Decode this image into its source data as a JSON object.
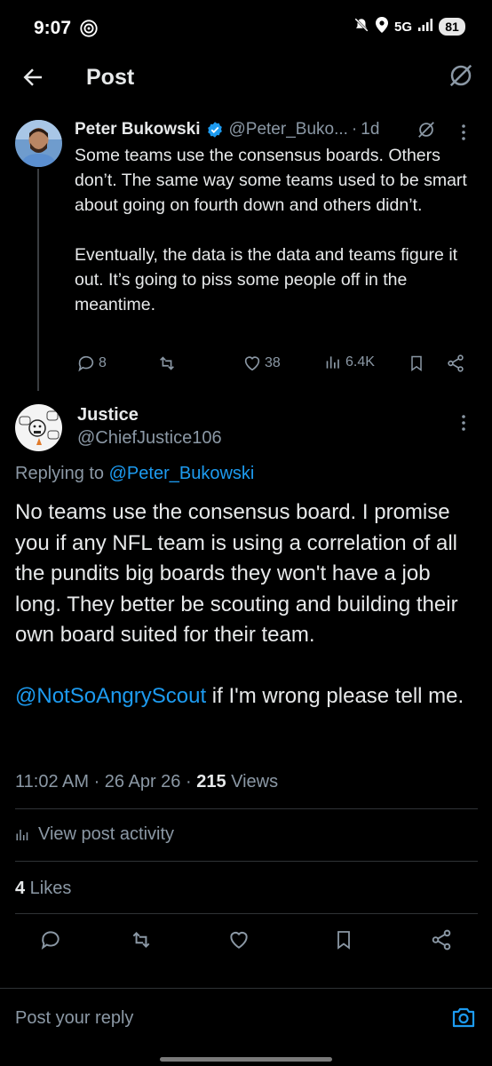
{
  "status_bar": {
    "time": "9:07",
    "network": "5G",
    "battery": "81"
  },
  "header": {
    "title": "Post"
  },
  "parent_post": {
    "author_name": "Peter Bukowski",
    "handle": "@Peter_Buko...",
    "dot": "·",
    "time": "1d",
    "paragraphs": [
      "Some teams use the consensus boards. Others don’t. The same way some teams used to be smart about going on fourth down and others didn’t.",
      "Eventually, the data is the data and teams figure it out. It’s going to piss some people off in the meantime."
    ],
    "replies": "8",
    "reposts": "",
    "likes": "38",
    "views": "6.4K"
  },
  "reply_post": {
    "author_name": "Justice",
    "handle": "@ChiefJustice106",
    "replying_prefix": "Replying to ",
    "replying_to": "@Peter_Bukowski",
    "paragraph1": "No teams use the consensus board.  I promise you if any NFL team is using a correlation of all the pundits big boards they won't have a job long.  They better be scouting and building their own board suited for their team.",
    "mention": "@NotSoAngryScout",
    "paragraph2_rest": " if I'm wrong please tell me.",
    "timestamp": "11:02 AM · 26 Apr 26 · ",
    "view_count": "215",
    "views_label": " Views",
    "activity_label": "View post activity",
    "likes_count": "4",
    "likes_label": " Likes"
  },
  "composer": {
    "placeholder": "Post your reply"
  },
  "colors": {
    "accent": "#1d9bf0",
    "background": "#000000",
    "muted": "#8b98a5",
    "text": "#e7e9ea"
  }
}
